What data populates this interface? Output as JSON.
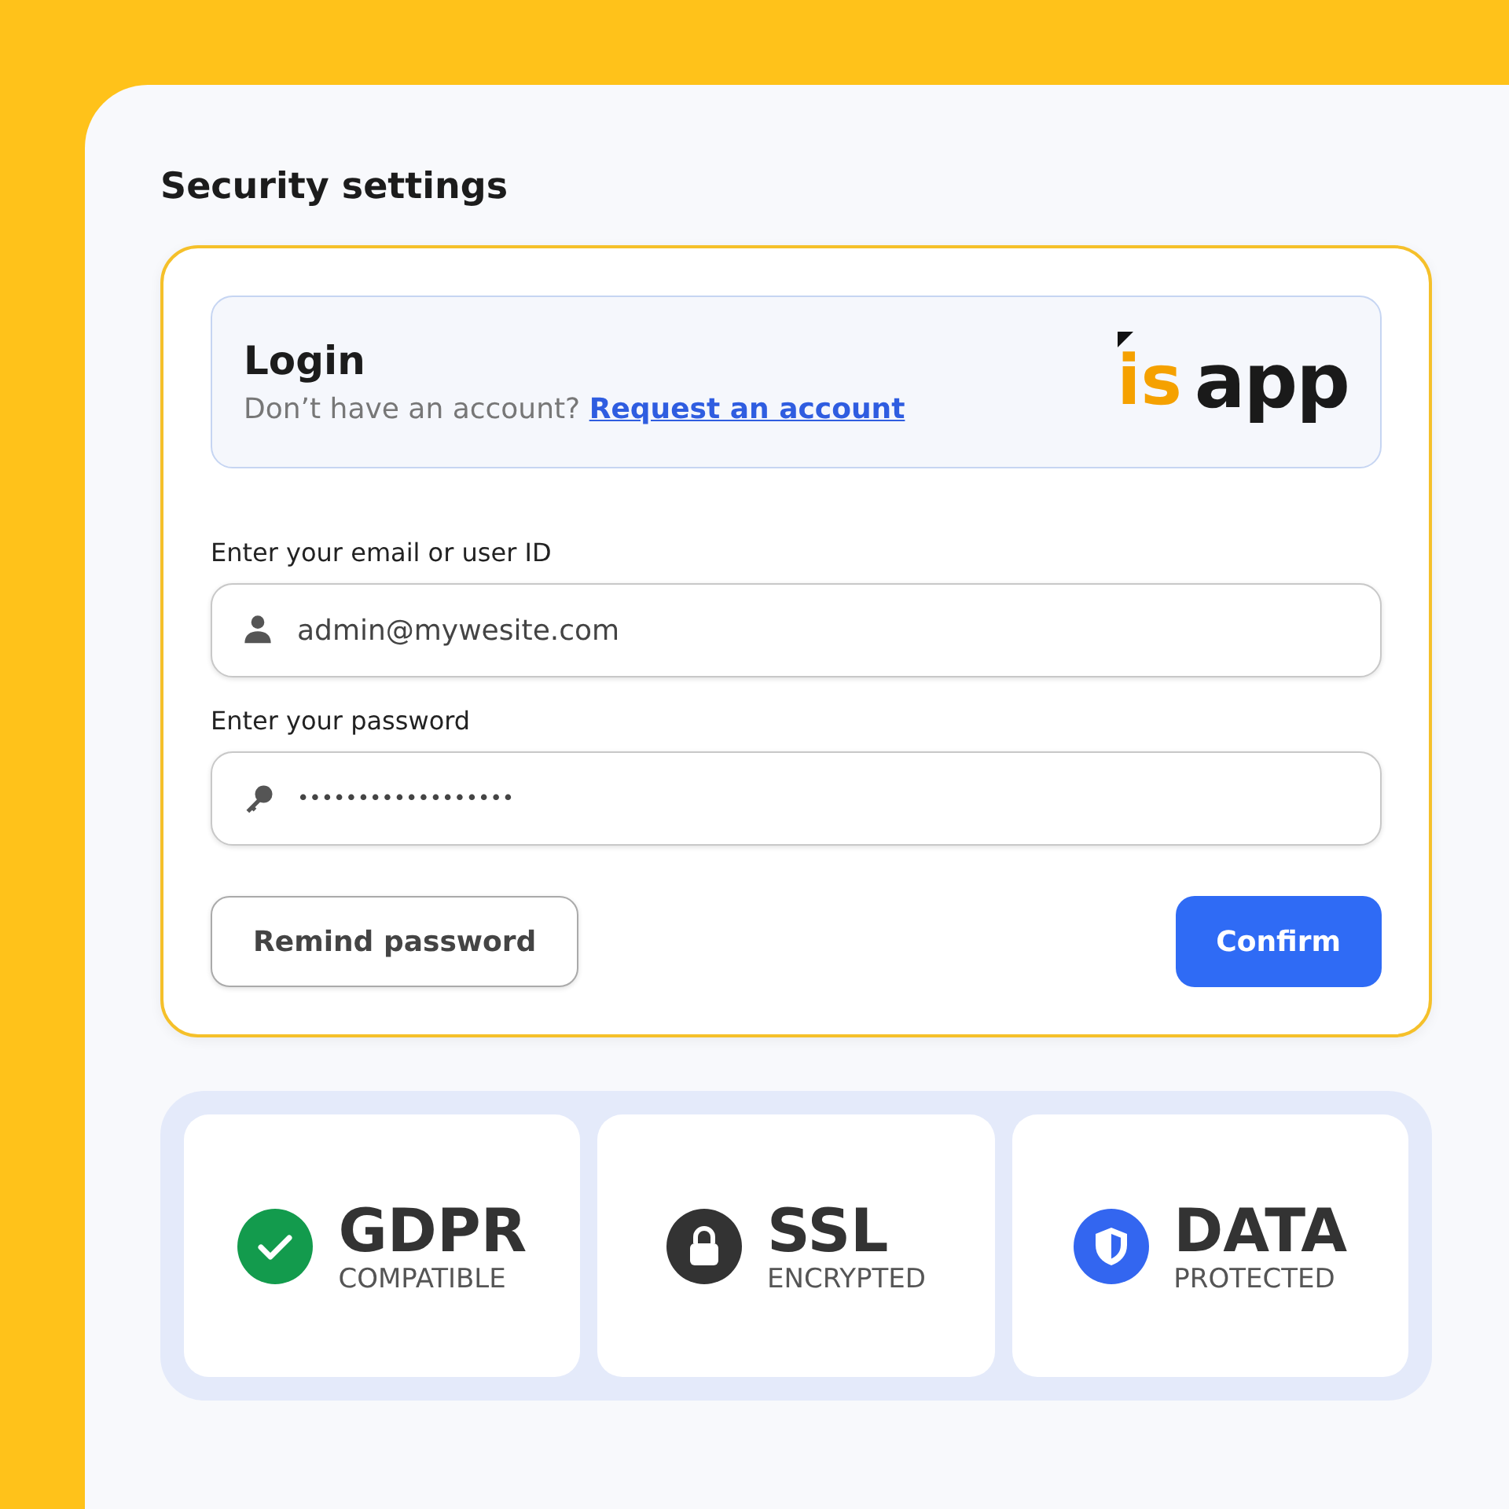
{
  "title": "Security settings",
  "login": {
    "heading": "Login",
    "prompt": "Don’t have an account?",
    "link": "Request an account",
    "logo": {
      "mark": "is",
      "name": "app"
    }
  },
  "fields": [
    {
      "kind": "user",
      "label": "Enter your email or user ID",
      "value": "admin@mywesite.com"
    },
    {
      "kind": "password",
      "label": "Enter your password",
      "value": "••••••••••••••••••"
    }
  ],
  "buttons": [
    {
      "kind": "secondary",
      "label": "Remind password"
    },
    {
      "kind": "primary",
      "label": "Confirm"
    }
  ],
  "badges": [
    {
      "kind": "check",
      "color": "#139b4d",
      "title": "GDPR",
      "subtitle": "COMPATIBLE"
    },
    {
      "kind": "lock",
      "color": "#333333",
      "title": "SSL",
      "subtitle": "ENCRYPTED"
    },
    {
      "kind": "shield",
      "color": "#3366f0",
      "title": "DATA",
      "subtitle": "PROTECTED"
    }
  ]
}
